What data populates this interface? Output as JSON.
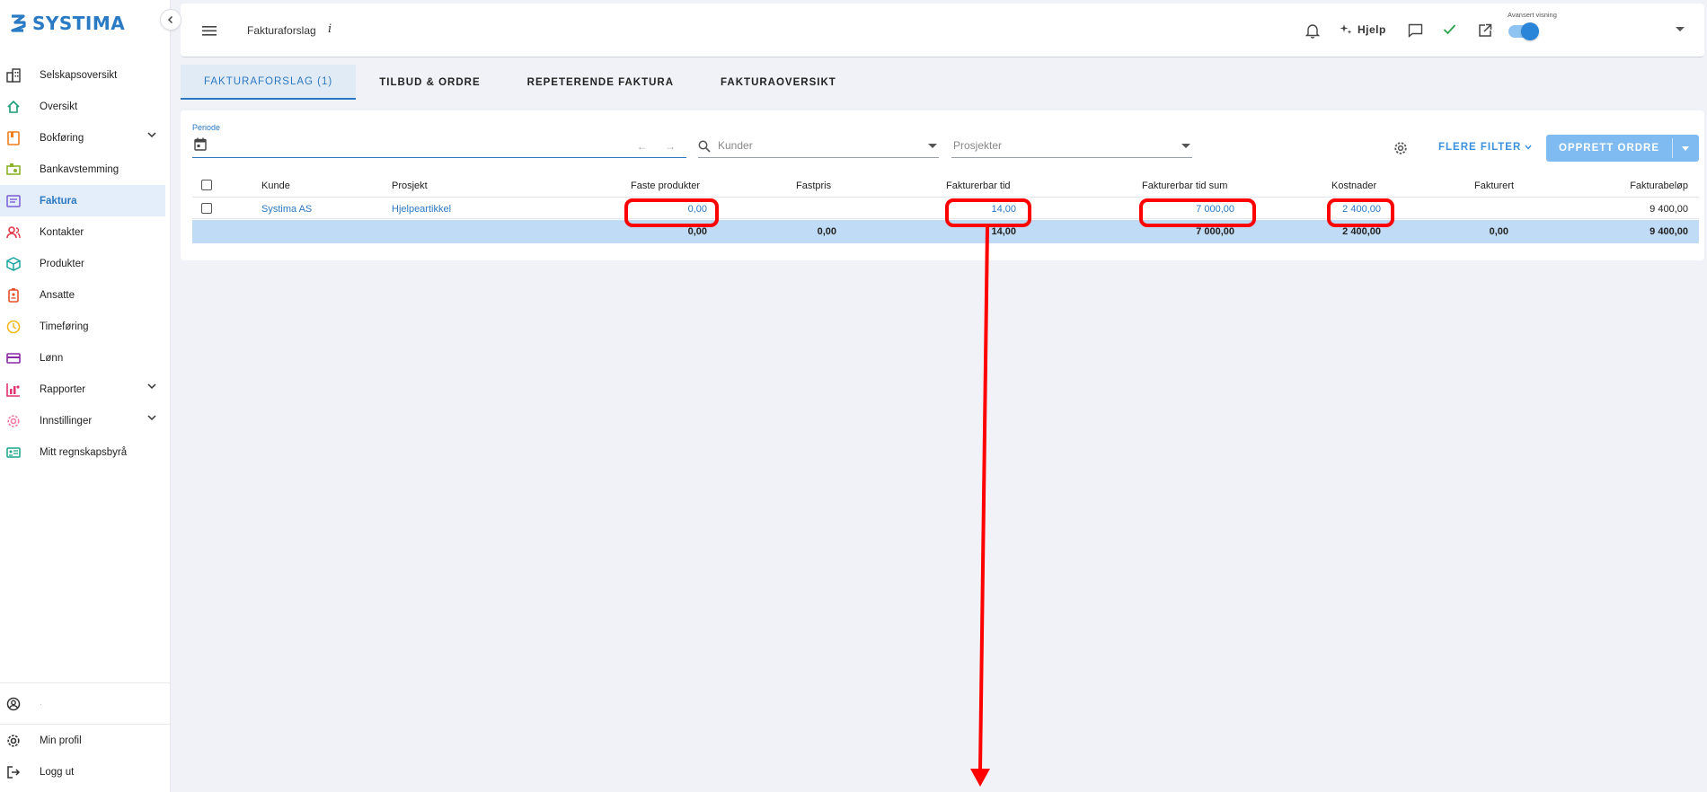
{
  "brand": {
    "name": "SYSTIMA",
    "color": "#2a7ac4"
  },
  "sidebar": {
    "collapse_icon": "chevron-left-icon",
    "items": [
      {
        "label": "Selskapsoversikt",
        "icon": "buildings-icon"
      },
      {
        "label": "Oversikt",
        "icon": "home-icon"
      },
      {
        "label": "Bokføring",
        "icon": "ledger-icon",
        "expandable": true
      },
      {
        "label": "Bankavstemming",
        "icon": "bank-icon"
      },
      {
        "label": "Faktura",
        "icon": "invoice-icon",
        "active": true
      },
      {
        "label": "Kontakter",
        "icon": "contacts-icon"
      },
      {
        "label": "Produkter",
        "icon": "cube-icon"
      },
      {
        "label": "Ansatte",
        "icon": "badge-icon"
      },
      {
        "label": "Timeføring",
        "icon": "clock-icon"
      },
      {
        "label": "Lønn",
        "icon": "card-icon"
      },
      {
        "label": "Rapporter",
        "icon": "bar-chart-icon",
        "expandable": true
      },
      {
        "label": "Innstillinger",
        "icon": "gear-icon",
        "expandable": true
      },
      {
        "label": "Mitt regnskapsbyrå",
        "icon": "id-card-icon"
      }
    ],
    "bottom": {
      "user_name": "·",
      "profile": "Min profil",
      "logout": "Logg ut"
    }
  },
  "header": {
    "title": "Fakturaforslag",
    "info": "i",
    "help": "Hjelp",
    "advanced_view_label": "Avansert visning",
    "advanced_view_on": true
  },
  "tabs": [
    {
      "label": "FAKTURAFORSLAG (1)",
      "active": true
    },
    {
      "label": "TILBUD & ORDRE"
    },
    {
      "label": "REPETERENDE FAKTURA"
    },
    {
      "label": "FAKTURAOVERSIKT"
    }
  ],
  "filters": {
    "periode_label": "Periode",
    "arrows": "← →",
    "kunder_placeholder": "Kunder",
    "prosjekter_placeholder": "Prosjekter",
    "more_filters": "FLERE FILTER",
    "create_order": "OPPRETT ORDRE"
  },
  "table": {
    "headers": {
      "kunde": "Kunde",
      "prosjekt": "Prosjekt",
      "faste_produkter": "Faste produkter",
      "fastpris": "Fastpris",
      "fakturerbar_tid": "Fakturerbar tid",
      "fakturerbar_tid_sum": "Fakturerbar tid sum",
      "kostnader": "Kostnader",
      "fakturert": "Fakturert",
      "fakturabelop": "Fakturabeløp"
    },
    "rows": [
      {
        "kunde": "Systima AS",
        "prosjekt": "Hjelpeartikkel",
        "faste_produkter": "0,00",
        "fastpris": "",
        "fakturerbar_tid": "14,00",
        "fakturerbar_tid_sum": "7 000,00",
        "kostnader": "2 400,00",
        "fakturert": "",
        "fakturabelop": "9 400,00"
      }
    ],
    "totals": {
      "faste_produkter": "0,00",
      "fastpris": "0,00",
      "fakturerbar_tid": "14,00",
      "fakturerbar_tid_sum": "7 000,00",
      "kostnader": "2 400,00",
      "fakturert": "0,00",
      "fakturabelop": "9 400,00"
    }
  },
  "colors": {
    "accent": "#2a78c2",
    "active_nav_bg": "#e4eefa",
    "sum_row_bg": "#bfdbf5",
    "primary_button": "#7fbbf0",
    "annotation": "#ff0000"
  }
}
